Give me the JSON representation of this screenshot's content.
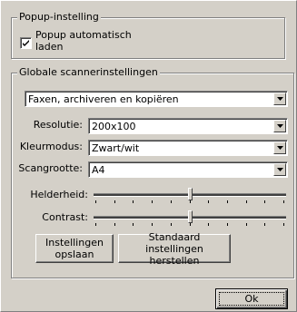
{
  "popup_group": {
    "legend": "Popup-instelling",
    "checkbox_label_line1": "Popup automatisch",
    "checkbox_label_line2": "laden",
    "checked": true
  },
  "scanner_group": {
    "legend": "Globale scannerinstellingen",
    "mode_value": "Faxen, archiveren en kopiëren",
    "resolution_label": "Resolutie:",
    "resolution_value": "200x100",
    "color_label": "Kleurmodus:",
    "color_value": "Zwart/wit",
    "size_label": "Scangrootte:",
    "size_value": "A4",
    "brightness_label": "Helderheid:",
    "brightness_level": 0.5,
    "contrast_label": "Contrast:",
    "contrast_level": 0.5,
    "save_button_line1": "Instellingen",
    "save_button_line2": "opslaan",
    "restore_button_line1": "Standaard instellingen",
    "restore_button_line2": "herstellen"
  },
  "ok_button": "Ok",
  "icons": {
    "checkmark": "checkmark-icon",
    "dropdown": "chevron-down-icon"
  }
}
